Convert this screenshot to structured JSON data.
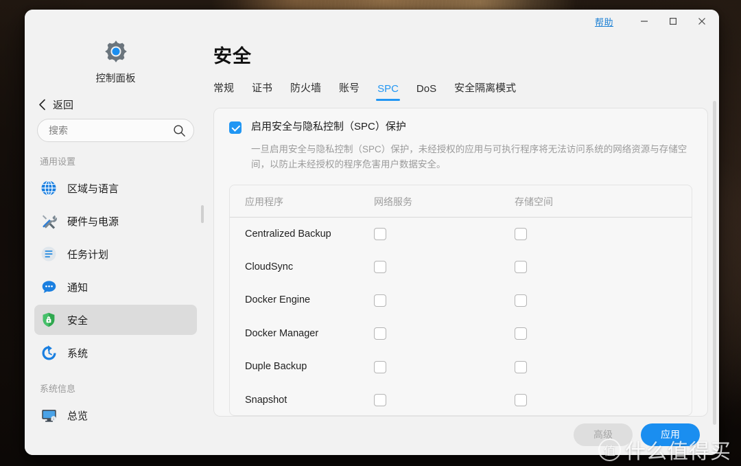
{
  "window": {
    "help_label": "帮助",
    "minimize_icon": "minimize-icon",
    "maximize_icon": "maximize-icon",
    "close_icon": "close-icon"
  },
  "sidebar": {
    "brand_icon": "gear-icon",
    "brand_label": "控制面板",
    "back_label": "返回",
    "search": {
      "value": "",
      "placeholder": "搜索",
      "icon": "search-icon"
    },
    "groups": [
      {
        "title": "通用设置",
        "items": [
          {
            "label": "区域与语言",
            "icon": "globe-icon",
            "active": false
          },
          {
            "label": "硬件与电源",
            "icon": "tools-icon",
            "active": false
          },
          {
            "label": "任务计划",
            "icon": "task-list-icon",
            "active": false
          },
          {
            "label": "通知",
            "icon": "chat-bubble-icon",
            "active": false
          },
          {
            "label": "安全",
            "icon": "shield-lock-icon",
            "active": true
          },
          {
            "label": "系统",
            "icon": "power-refresh-icon",
            "active": false
          }
        ]
      },
      {
        "title": "系统信息",
        "items": [
          {
            "label": "总览",
            "icon": "monitor-icon",
            "active": false
          }
        ]
      }
    ]
  },
  "main": {
    "page_title": "安全",
    "tabs": [
      {
        "label": "常规",
        "active": false
      },
      {
        "label": "证书",
        "active": false
      },
      {
        "label": "防火墙",
        "active": false
      },
      {
        "label": "账号",
        "active": false
      },
      {
        "label": "SPC",
        "active": true
      },
      {
        "label": "DoS",
        "active": false
      },
      {
        "label": "安全隔离模式",
        "active": false
      }
    ],
    "spc": {
      "enable_label": "启用安全与隐私控制（SPC）保护",
      "enabled": true,
      "description": "一旦启用安全与隐私控制（SPC）保护，未经授权的应用与可执行程序将无法访问系统的网络资源与存储空间，以防止未经授权的程序危害用户数据安全。"
    },
    "table": {
      "columns": [
        "应用程序",
        "网络服务",
        "存储空间"
      ],
      "rows": [
        {
          "app": "Centralized Backup",
          "network": false,
          "storage": false
        },
        {
          "app": "CloudSync",
          "network": false,
          "storage": false
        },
        {
          "app": "Docker Engine",
          "network": false,
          "storage": false
        },
        {
          "app": "Docker Manager",
          "network": false,
          "storage": false
        },
        {
          "app": "Duple Backup",
          "network": false,
          "storage": false
        },
        {
          "app": "Snapshot",
          "network": false,
          "storage": false
        }
      ]
    },
    "footer": {
      "advanced_label": "高级",
      "apply_label": "应用"
    }
  },
  "watermark": {
    "mark": "值",
    "text": "什么值得买"
  },
  "colors": {
    "accent": "#2196f3",
    "primary_button": "#1a8ef0",
    "link": "#1a7fd4",
    "window_bg": "#f2f2f2",
    "card_bg": "#f7f7f7",
    "active_nav_bg": "#dcdcdc",
    "muted_text": "#9b9b9b"
  }
}
